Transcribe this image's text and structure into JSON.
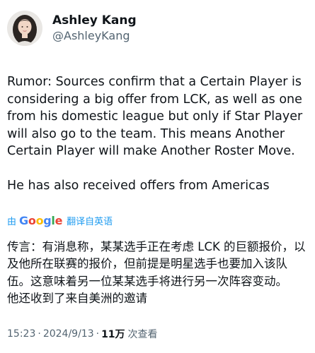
{
  "author": {
    "display_name": "Ashley Kang",
    "handle": "@AshleyKang"
  },
  "tweet": {
    "text": "Rumor: Sources confirm that a Certain Player is considering a big offer from LCK, as well as one from his domestic league but only if Star Player will also go to the team. This means Another Certain Player will make Another Roster Move.\n\nHe has also received offers from Americas",
    "translation": {
      "by_label": "由",
      "google_letters": [
        "G",
        "o",
        "o",
        "g",
        "l",
        "e"
      ],
      "google_colors": [
        "#4285F4",
        "#EA4335",
        "#FBBC05",
        "#4285F4",
        "#34A853",
        "#EA4335"
      ],
      "action_label": "翻译自英语",
      "text": "传言：有消息称，某某选手正在考虑 LCK 的巨额报价，以及他所在联赛的报价，但前提是明星选手也要加入该队伍。这意味着另一位某某选手将进行另一次阵容变动。\n他还收到了来自美洲的邀请"
    }
  },
  "meta": {
    "time": "15:23",
    "separator": "·",
    "date": "2024/9/13",
    "views_count": "11万",
    "views_label": "次查看"
  },
  "colors": {
    "link": "#1d9bf0",
    "secondary_text": "#536471",
    "primary_text": "#0f1419"
  }
}
